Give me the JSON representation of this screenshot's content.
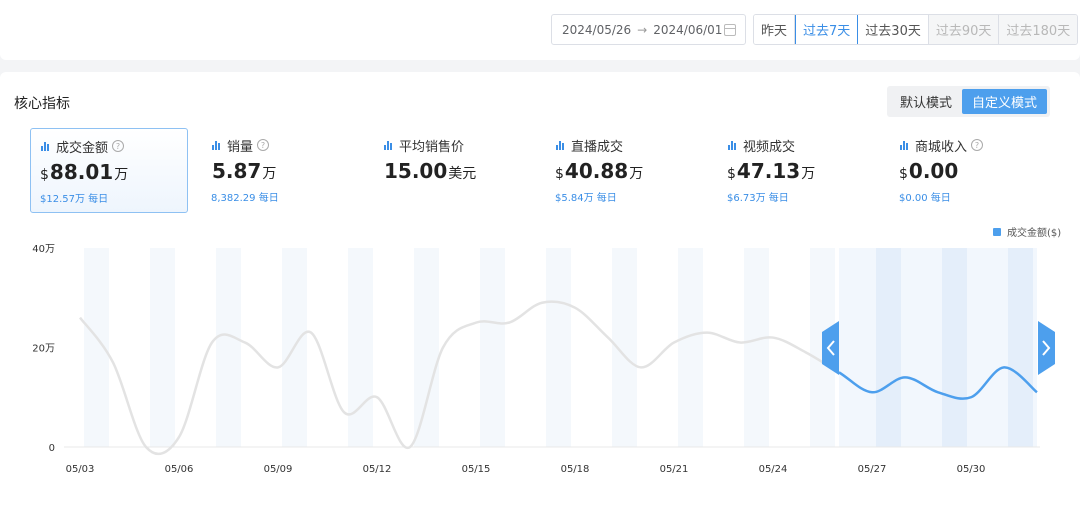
{
  "header": {
    "date_start": "2024/05/26",
    "date_arrow": "→",
    "date_end": "2024/06/01",
    "ranges": [
      {
        "label": "昨天",
        "state": "normal"
      },
      {
        "label": "过去7天",
        "state": "active"
      },
      {
        "label": "过去30天",
        "state": "normal"
      },
      {
        "label": "过去90天",
        "state": "disabled"
      },
      {
        "label": "过去180天",
        "state": "disabled"
      }
    ]
  },
  "section": {
    "title": "核心指标",
    "modes": [
      "默认模式",
      "自定义模式"
    ],
    "active_mode": "自定义模式"
  },
  "metrics": [
    {
      "label": "成交金额",
      "has_help": true,
      "prefix": "$",
      "value": "88.01",
      "unit": "万",
      "sub": "$12.57万 每日",
      "selected": true
    },
    {
      "label": "销量",
      "has_help": true,
      "prefix": "",
      "value": "5.87",
      "unit": "万",
      "sub": "8,382.29 每日",
      "selected": false
    },
    {
      "label": "平均销售价",
      "has_help": false,
      "prefix": "",
      "value": "15.00",
      "unit": "美元",
      "sub": "",
      "selected": false
    },
    {
      "label": "直播成交",
      "has_help": false,
      "prefix": "$",
      "value": "40.88",
      "unit": "万",
      "sub": "$5.84万 每日",
      "selected": false
    },
    {
      "label": "视频成交",
      "has_help": false,
      "prefix": "$",
      "value": "47.13",
      "unit": "万",
      "sub": "$6.73万 每日",
      "selected": false
    },
    {
      "label": "商城收入",
      "has_help": true,
      "prefix": "$",
      "value": "0.00",
      "unit": "",
      "sub": "$0.00 每日",
      "selected": false
    }
  ],
  "chart_data": {
    "type": "line",
    "series": [
      {
        "name": "成交金额($)",
        "x": [
          "05/03",
          "05/04",
          "05/05",
          "05/06",
          "05/07",
          "05/08",
          "05/09",
          "05/10",
          "05/11",
          "05/12",
          "05/13",
          "05/14",
          "05/15",
          "05/16",
          "05/17",
          "05/18",
          "05/19",
          "05/20",
          "05/21",
          "05/22",
          "05/23",
          "05/24",
          "05/25",
          "05/26",
          "05/27",
          "05/28",
          "05/29",
          "05/30",
          "05/31",
          "06/01"
        ],
        "values": [
          26,
          17,
          0,
          2,
          21,
          21,
          16,
          23,
          7,
          10,
          0,
          20,
          25,
          25,
          29,
          28,
          22,
          16,
          21,
          23,
          21,
          22,
          19,
          15,
          11,
          14,
          11,
          10,
          16,
          11
        ]
      }
    ],
    "ylim": [
      0,
      40
    ],
    "yticks": [
      "0",
      "20万",
      "40万"
    ],
    "xticks": [
      "05/03",
      "05/06",
      "05/09",
      "05/12",
      "05/15",
      "05/18",
      "05/21",
      "05/24",
      "05/27",
      "05/30"
    ],
    "highlight_range": [
      "05/26",
      "06/01"
    ],
    "legend": "top-right",
    "colors": {
      "line": "#4d9fed",
      "context_line": "#e3e3e3",
      "band": "#f4f8fc",
      "handle": "#4d9fed"
    }
  }
}
